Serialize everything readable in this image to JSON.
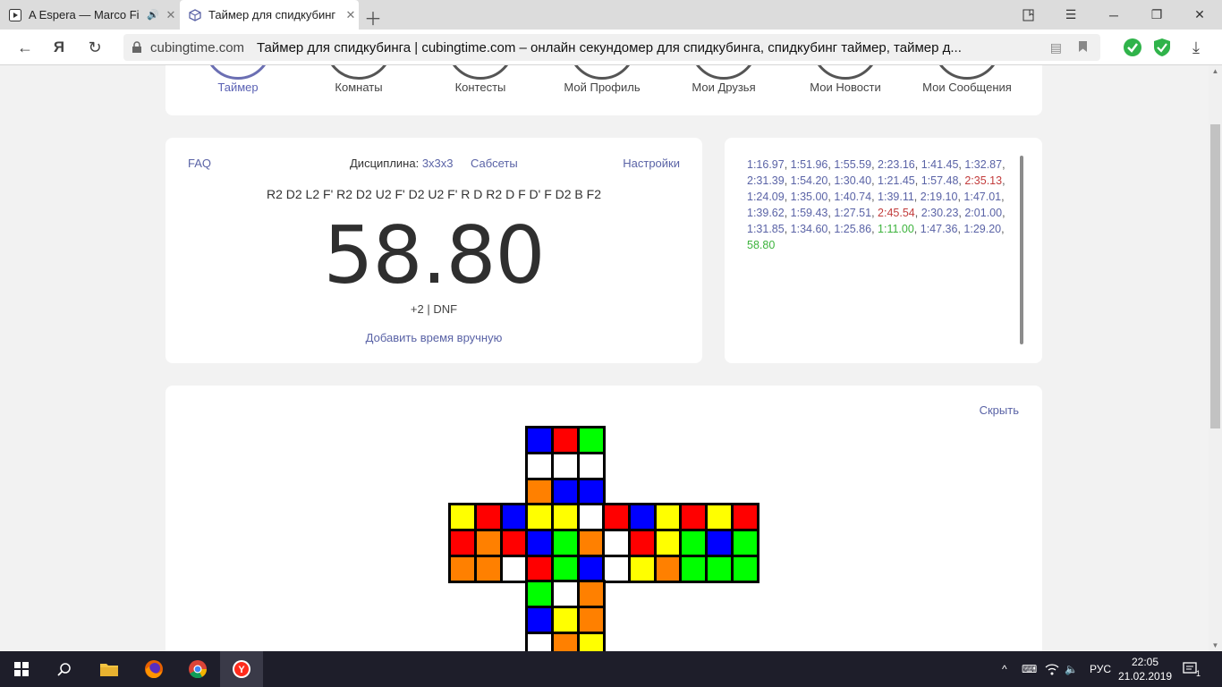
{
  "browser": {
    "tabs": [
      {
        "title": "A Espera — Marco Fi",
        "icon": "play-icon",
        "has_audio": true
      },
      {
        "title": "Таймер для спидкубинг",
        "icon": "cube-icon",
        "active": true
      }
    ],
    "address": {
      "domain": "cubingtime.com",
      "title": "Таймер для спидкубинга | cubingtime.com – онлайн секундомер для спидкубинга, спидкубинг таймер, таймер д..."
    }
  },
  "menu": {
    "items": [
      {
        "label": "Таймер",
        "active": true
      },
      {
        "label": "Комнаты"
      },
      {
        "label": "Контесты"
      },
      {
        "label": "Мой Профиль"
      },
      {
        "label": "Мои Друзья"
      },
      {
        "label": "Мои Новости"
      },
      {
        "label": "Мои Сообщения"
      }
    ]
  },
  "timer": {
    "faq": "FAQ",
    "discipline_label": "Дисциплина:",
    "discipline_value": "3x3x3",
    "subsets": "Сабсеты",
    "settings": "Настройки",
    "scramble": "R2 D2 L2 F' R2 D2 U2 F' D2 U2 F' R D R2 D F D' F D2 B F2",
    "time": "58.80",
    "penalty": "+2 | DNF",
    "add_manual": "Добавить время вручную"
  },
  "times": [
    {
      "v": "1:16.97"
    },
    {
      "v": "1:51.96"
    },
    {
      "v": "1:55.59"
    },
    {
      "v": "2:23.16"
    },
    {
      "v": "1:41.45"
    },
    {
      "v": "1:32.87"
    },
    {
      "v": "2:31.39"
    },
    {
      "v": "1:54.20"
    },
    {
      "v": "1:30.40"
    },
    {
      "v": "1:21.45"
    },
    {
      "v": "1:57.48"
    },
    {
      "v": "2:35.13",
      "k": "worst"
    },
    {
      "v": "1:24.09"
    },
    {
      "v": "1:35.00"
    },
    {
      "v": "1:40.74"
    },
    {
      "v": "1:39.11"
    },
    {
      "v": "2:19.10"
    },
    {
      "v": "1:47.01"
    },
    {
      "v": "1:39.62"
    },
    {
      "v": "1:59.43"
    },
    {
      "v": "1:27.51"
    },
    {
      "v": "2:45.54",
      "k": "worst"
    },
    {
      "v": "2:30.23"
    },
    {
      "v": "2:01.00"
    },
    {
      "v": "1:31.85"
    },
    {
      "v": "1:34.60"
    },
    {
      "v": "1:25.86"
    },
    {
      "v": "1:11.00",
      "k": "best"
    },
    {
      "v": "1:47.36"
    },
    {
      "v": "1:29.20"
    },
    {
      "v": "58.80",
      "k": "best"
    }
  ],
  "cube": {
    "hide": "Скрыть",
    "colors": {
      "B": "#0000ff",
      "R": "#ff0000",
      "G": "#00ff00",
      "W": "#ffffff",
      "O": "#ff8000",
      "Y": "#ffff00"
    },
    "faces": {
      "top": [
        "B",
        "R",
        "G",
        "W",
        "W",
        "W",
        "O",
        "B",
        "B"
      ],
      "left": [
        "Y",
        "R",
        "B",
        "R",
        "O",
        "R",
        "O",
        "O",
        "W"
      ],
      "front": [
        "Y",
        "Y",
        "W",
        "B",
        "G",
        "O",
        "R",
        "G",
        "B"
      ],
      "right": [
        "R",
        "B",
        "Y",
        "W",
        "R",
        "Y",
        "W",
        "Y",
        "O"
      ],
      "back": [
        "R",
        "Y",
        "R",
        "G",
        "B",
        "G",
        "G",
        "G",
        "G"
      ],
      "bottom": [
        "G",
        "W",
        "O",
        "B",
        "Y",
        "O",
        "W",
        "O",
        "Y"
      ]
    }
  },
  "taskbar": {
    "lang": "РУС",
    "time": "22:05",
    "date": "21.02.2019",
    "notifications": "1"
  }
}
